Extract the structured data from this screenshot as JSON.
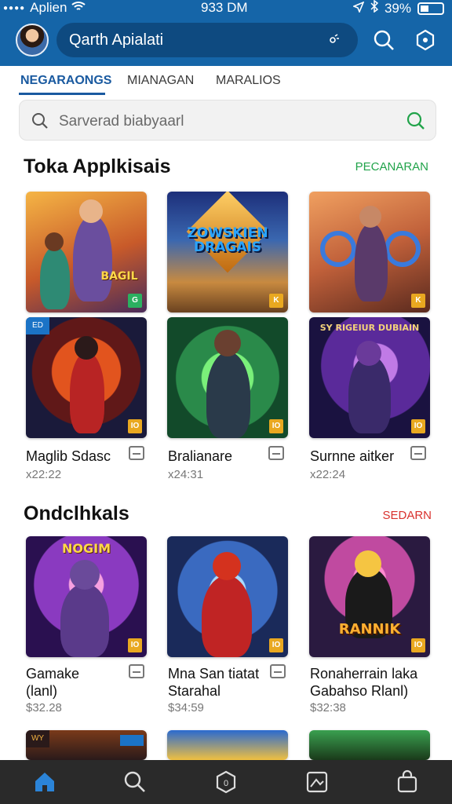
{
  "status_bar": {
    "carrier": "Aplien",
    "time": "933 DM",
    "battery": "39%"
  },
  "header": {
    "title": "Qarth Apialati"
  },
  "tabs": [
    {
      "label": "NEGARAONGS",
      "active": true
    },
    {
      "label": "MIANAGAN",
      "active": false
    },
    {
      "label": "MARALIOS",
      "active": false
    }
  ],
  "search": {
    "placeholder": "Sarverad biabyaarl"
  },
  "section1": {
    "title": "Toka Applkisais",
    "action": "PECANARAN",
    "action_color": "#21a34a",
    "cards_top": [
      {
        "art": "heroes",
        "caption": "BAGIL"
      },
      {
        "art": "logo",
        "caption": "ZOWSKIEN DRAGAIS"
      },
      {
        "art": "warrior",
        "caption": ""
      }
    ],
    "apps": [
      {
        "name": "Maglib Sdasc",
        "price": "x22:22"
      },
      {
        "name": "Bralianare",
        "price": "x24:31"
      },
      {
        "name": "Surnne aitker",
        "price": "x22:24"
      }
    ]
  },
  "section2": {
    "title": "Ondclhkals",
    "action": "SEDARN",
    "action_color": "#d9322e",
    "cards_top": [
      {
        "art": "goblin",
        "caption": "NOGIM"
      },
      {
        "art": "red-hero",
        "caption": ""
      },
      {
        "art": "rocker",
        "caption": "RANNIK"
      }
    ],
    "apps": [
      {
        "name_line1": "Gamake",
        "name_line2": "(lanl)",
        "price": "$32.28"
      },
      {
        "name_line1": "Mna San tiatat",
        "name_line2": "Starahal",
        "price": "$34:59"
      },
      {
        "name_line1": "Ronaherrain laka",
        "name_line2": "Gabahso Rlanl)",
        "price": "$32:38"
      }
    ]
  },
  "colors": {
    "header_bg": "#1565a8",
    "accent": "#1a5aa0",
    "badge": "#e9a820",
    "nav_bg": "#2a2a2a",
    "nav_active": "#2b84d8"
  },
  "bottom_nav": [
    {
      "icon": "home-icon",
      "active": true
    },
    {
      "icon": "search-icon",
      "active": false
    },
    {
      "icon": "badge-icon",
      "active": false
    },
    {
      "icon": "map-icon",
      "active": false
    },
    {
      "icon": "bag-icon",
      "active": false
    }
  ]
}
